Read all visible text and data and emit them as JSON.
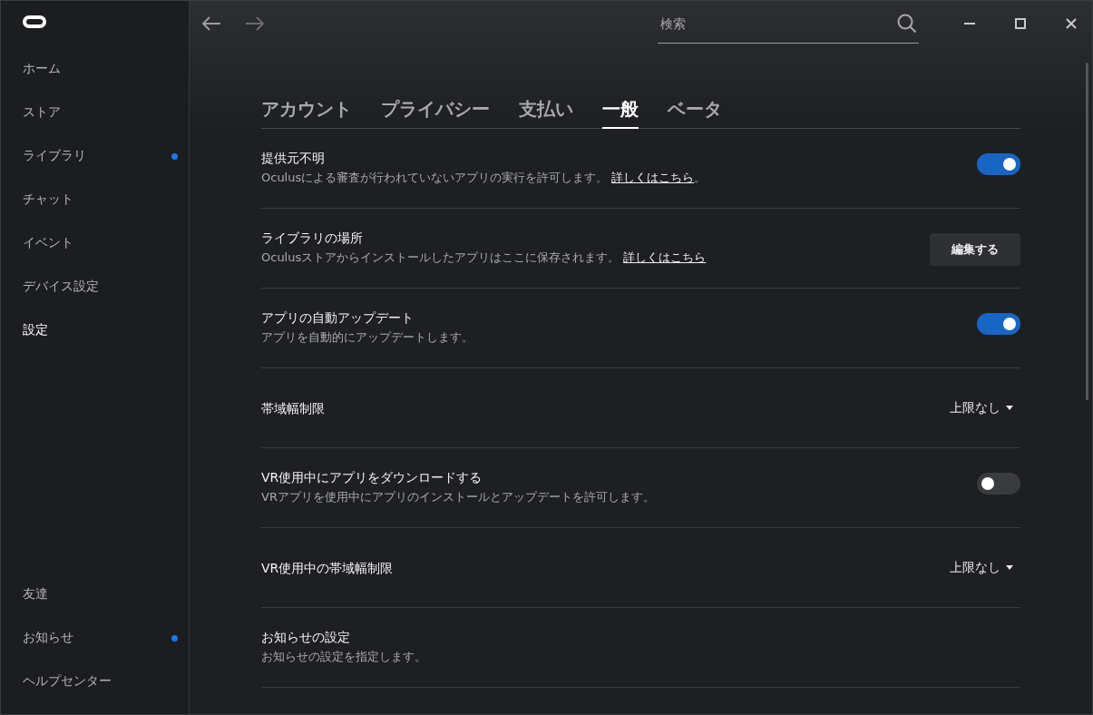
{
  "sidebar": {
    "items": [
      {
        "label": "ホーム",
        "selected": false,
        "badge": false
      },
      {
        "label": "ストア",
        "selected": false,
        "badge": false
      },
      {
        "label": "ライブラリ",
        "selected": false,
        "badge": true
      },
      {
        "label": "チャット",
        "selected": false,
        "badge": false
      },
      {
        "label": "イベント",
        "selected": false,
        "badge": false
      },
      {
        "label": "デバイス設定",
        "selected": false,
        "badge": false
      },
      {
        "label": "設定",
        "selected": true,
        "badge": false
      }
    ],
    "bottom_items": [
      {
        "label": "友達",
        "selected": false,
        "badge": false
      },
      {
        "label": "お知らせ",
        "selected": false,
        "badge": true
      },
      {
        "label": "ヘルプセンター",
        "selected": false,
        "badge": false
      }
    ]
  },
  "search": {
    "placeholder": "検索"
  },
  "tabs": [
    {
      "label": "アカウント",
      "selected": false
    },
    {
      "label": "プライバシー",
      "selected": false
    },
    {
      "label": "支払い",
      "selected": false
    },
    {
      "label": "一般",
      "selected": true
    },
    {
      "label": "ベータ",
      "selected": false
    }
  ],
  "settings": [
    {
      "kind": "toggle",
      "title": "提供元不明",
      "description": "Oculusによる審査が行われていないアプリの実行を許可します。",
      "link": "詳しくはこちら",
      "after": "。",
      "on": true
    },
    {
      "kind": "button",
      "title": "ライブラリの場所",
      "description": "Oculusストアからインストールしたアプリはここに保存されます。",
      "link": "詳しくはこちら",
      "button": "編集する"
    },
    {
      "kind": "toggle",
      "title": "アプリの自動アップデート",
      "description": "アプリを自動的にアップデートします。",
      "on": true
    },
    {
      "kind": "dropdown",
      "title": "帯域幅制限",
      "value": "上限なし"
    },
    {
      "kind": "toggle",
      "title": "VR使用中にアプリをダウンロードする",
      "description": "VRアプリを使用中にアプリのインストールとアップデートを許可します。",
      "on": false
    },
    {
      "kind": "dropdown",
      "title": "VR使用中の帯域幅制限",
      "value": "上限なし"
    },
    {
      "kind": "plain",
      "title": "お知らせの設定",
      "description": "お知らせの設定を指定します。"
    }
  ]
}
